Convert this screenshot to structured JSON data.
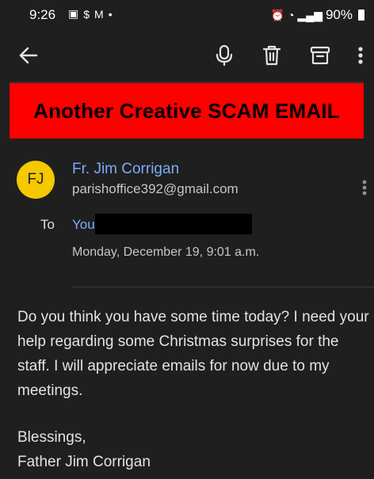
{
  "status_bar": {
    "time": "9:26",
    "left_icons": [
      "sim-icon",
      "money-icon",
      "gmail-icon",
      "dot-icon"
    ],
    "battery": "90%"
  },
  "toolbar": {
    "back_icon": "back-arrow-icon",
    "mic_icon": "mic-icon",
    "trash_icon": "trash-icon",
    "archive_icon": "archive-icon",
    "more_icon": "more-vert-icon"
  },
  "banner": {
    "text": "Another Creative SCAM EMAIL",
    "color": "#ff0000"
  },
  "sender": {
    "initials": "FJ",
    "name": "Fr. Jim Corrigan",
    "email": "parishoffice392@gmail.com",
    "avatar_color": "#f6c800"
  },
  "recipient": {
    "to_label": "To",
    "to_value": "You"
  },
  "date": "Monday, December 19, 9:01 a.m.",
  "body": {
    "paragraph": "Do you think you have some time today? I need your help regarding some Christmas surprises for the staff. I will appreciate emails for now due to my meetings.",
    "closing": "Blessings,",
    "signature": "Father Jim Corrigan"
  }
}
